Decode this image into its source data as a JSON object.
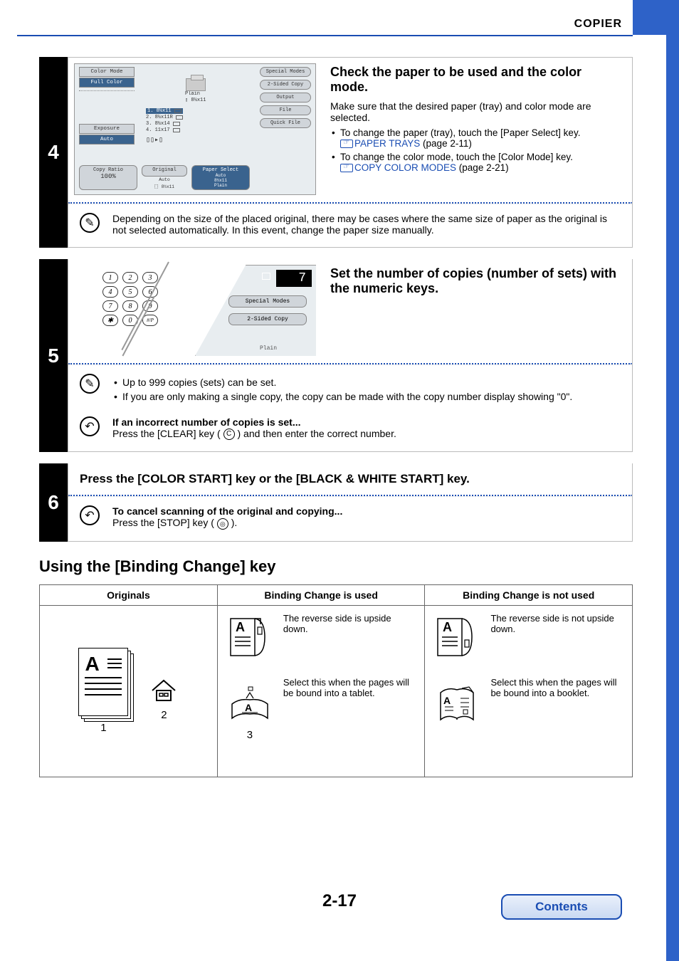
{
  "header": {
    "section": "COPIER"
  },
  "step4": {
    "number": "4",
    "heading": "Check the paper to be used and the color mode.",
    "description": "Make sure that the desired paper (tray) and color mode are selected.",
    "bullets": [
      {
        "text": "To change the paper (tray), touch the [Paper Select] key.",
        "link": "PAPER TRAYS",
        "page": "(page 2-11)"
      },
      {
        "text": "To change the color mode, touch the [Color Mode] key.",
        "link": "COPY COLOR MODES",
        "page": "(page 2-21)"
      }
    ],
    "note": "Depending on the size of the placed original, there may be cases where the same size of paper as the original is not selected automatically. In this event, change the paper size manually.",
    "lcd": {
      "left": {
        "color_mode_label": "Color Mode",
        "color_mode_value": "Full Color",
        "exposure_label": "Exposure",
        "exposure_value": "Auto"
      },
      "center": {
        "paper_type": "Plain",
        "paper_size": "8½x11"
      },
      "trays": [
        "1. 8½x11",
        "2. 8½x11R",
        "3. 8½x14",
        "4. 11x17"
      ],
      "right": [
        "Special Modes",
        "2-Sided Copy",
        "Output",
        "File",
        "Quick File"
      ],
      "bottom": {
        "copy_ratio_label": "Copy Ratio",
        "copy_ratio_value": "100%",
        "original_label": "Original",
        "original_value": "Auto",
        "original_size": "8½x11",
        "paper_select_label": "Paper Select",
        "paper_select_line1": "Auto",
        "paper_select_line2": "8½x11",
        "paper_select_line3": "Plain"
      }
    }
  },
  "step5": {
    "number": "5",
    "heading": "Set the number of copies (number of sets) with the numeric keys.",
    "lcd": {
      "count": "7",
      "buttons": [
        "Special Modes",
        "2-Sided Copy"
      ],
      "plain": "Plain"
    },
    "notes": [
      "Up to 999 copies (sets) can be set.",
      "If you are only making a single copy, the copy can be made with the copy number display showing \"0\"."
    ],
    "tip": {
      "heading": "If an incorrect number of copies is set...",
      "pre": "Press the [CLEAR] key (",
      "key": "C",
      "post": ") and then enter the correct number."
    }
  },
  "step6": {
    "number": "6",
    "heading": "Press the [COLOR START] key or the [BLACK & WHITE START] key.",
    "tip": {
      "heading": "To cancel scanning of the original and copying...",
      "pre": "Press the [STOP] key (",
      "key": "◎",
      "post": ")."
    }
  },
  "binding": {
    "heading": "Using the [Binding Change] key",
    "cols": [
      "Originals",
      "Binding Change is used",
      "Binding Change is not used"
    ],
    "originals": {
      "labels": [
        "1",
        "2"
      ]
    },
    "used": [
      "The reverse side is upside down.",
      "Select this when the pages will be bound into a tablet."
    ],
    "used_label": "3",
    "not_used": [
      "The reverse side is not upside down.",
      "Select this when the pages will be bound into a booklet."
    ]
  },
  "footer": {
    "page": "2-17",
    "contents": "Contents"
  }
}
